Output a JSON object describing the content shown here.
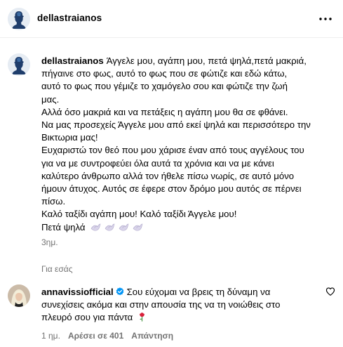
{
  "header": {
    "username": "dellastraianos"
  },
  "caption": {
    "username": "dellastraianos",
    "lines": [
      "Άγγελε μου, αγάπη μου, πετά ψηλά,πετά μακριά,",
      "πήγαινε στο φως, αυτό το φως που σε φώτιζε και εδώ κάτω,",
      "αυτό το φως που γέμιζε το χαμόγελο σου και φώτιζε την ζωή",
      "μας.",
      "Αλλά όσο μακριά και να πετάξεις η αγάπη μου θα σε φθάνει.",
      "Να μας προσεχείς Άγγελε μου από εκεί ψηλά και περισσότερο την",
      "Βικτωρια μας!",
      "Ευχαριστώ τον θεό που μου χάρισε έναν από τους αγγέλους του",
      "για να με συντροφεύει όλα αυτά τα χρόνια και να με κάνει",
      "καλύτερο άνθρωπο αλλά τον ήθελε πίσω νωρίς, σε αυτό μόνο",
      "ήμουν άτυχος. Αυτός σε έφερε στον δρόμο μου αυτός σε πέρνει",
      "πίσω.",
      "Καλό ταξίδι αγάπη μου! Καλό ταξίδι Άγγελε μου!",
      "Πετά ψηλά"
    ],
    "doves_icon": "dove-emoji",
    "time": "3ημ."
  },
  "translation": {
    "label": "Για εσάς"
  },
  "comment": {
    "username": "annavissiofficial",
    "verified_icon": "verified-badge-icon",
    "lines": [
      "Σου εύχομαι να βρεις τη δύναμη να",
      "συνεχίσεις ακόμα και στην απουσία της να τη νοιώθεις στο",
      "πλευρό σου για πάντα"
    ],
    "emoji": "rose-emoji",
    "time": "1 ημ.",
    "likes": "Αρέσει σε 401",
    "reply": "Απάντηση"
  },
  "colors": {
    "secondary_text": "#737373",
    "verified": "#0095f6",
    "divider": "#efefef"
  }
}
